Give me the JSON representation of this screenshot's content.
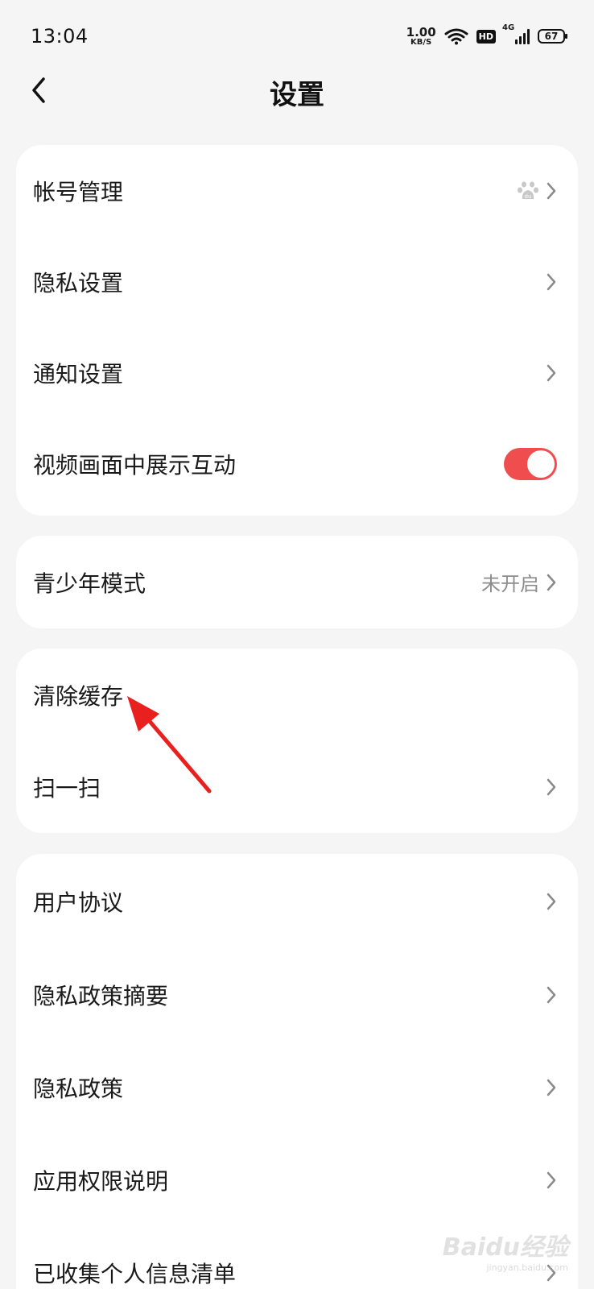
{
  "status_bar": {
    "time": "13:04",
    "net_speed_value": "1.00",
    "net_speed_unit": "KB/S",
    "hd": "HD",
    "network": "4G",
    "battery": "67"
  },
  "header": {
    "title": "设置",
    "back_icon": "back-arrow-icon"
  },
  "sections": [
    {
      "items": [
        {
          "label": "帐号管理",
          "right_icon": "baidu-paw-icon",
          "chevron": true
        },
        {
          "label": "隐私设置",
          "chevron": true
        },
        {
          "label": "通知设置",
          "chevron": true
        },
        {
          "label": "视频画面中展示互动",
          "toggle": true,
          "toggle_on": true
        }
      ]
    },
    {
      "items": [
        {
          "label": "青少年模式",
          "value": "未开启",
          "chevron": true
        }
      ]
    },
    {
      "items": [
        {
          "label": "清除缓存"
        },
        {
          "label": "扫一扫",
          "chevron": true
        }
      ]
    },
    {
      "items": [
        {
          "label": "用户协议",
          "chevron": true
        },
        {
          "label": "隐私政策摘要",
          "chevron": true
        },
        {
          "label": "隐私政策",
          "chevron": true
        },
        {
          "label": "应用权限说明",
          "chevron": true
        },
        {
          "label": "已收集个人信息清单",
          "chevron": true
        }
      ]
    }
  ],
  "colors": {
    "background": "#f5f5f5",
    "card": "#ffffff",
    "toggle_on": "#f04e4e",
    "annotation_arrow": "#e8211f"
  },
  "watermark": {
    "brand": "Baidu经验",
    "url": "jingyan.baidu.com"
  }
}
